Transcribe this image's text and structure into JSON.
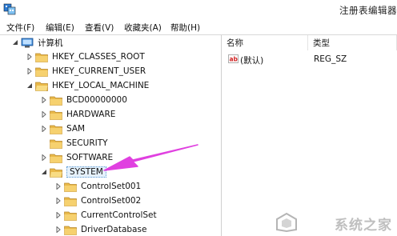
{
  "window": {
    "title": "注册表编辑器"
  },
  "menu": [
    "文件(F)",
    "编辑(E)",
    "查看(V)",
    "收藏夹(A)",
    "帮助(H)"
  ],
  "tree": {
    "root": "计算机",
    "hkcr": "HKEY_CLASSES_ROOT",
    "hkcu": "HKEY_CURRENT_USER",
    "hklm": "HKEY_LOCAL_MACHINE",
    "bcd": "BCD00000000",
    "hardware": "HARDWARE",
    "sam": "SAM",
    "security": "SECURITY",
    "software": "SOFTWARE",
    "system": "SYSTEM",
    "cs001": "ControlSet001",
    "cs002": "ControlSet002",
    "ccs": "CurrentControlSet",
    "driverdb": "DriverDatabase"
  },
  "list": {
    "headers": {
      "name": "名称",
      "type": "类型"
    },
    "rows": [
      {
        "name": "(默认)",
        "type": "REG_SZ"
      }
    ]
  },
  "annotation": {
    "arrow_color": "#e040e0"
  },
  "watermark": {
    "text": "系统之家"
  }
}
